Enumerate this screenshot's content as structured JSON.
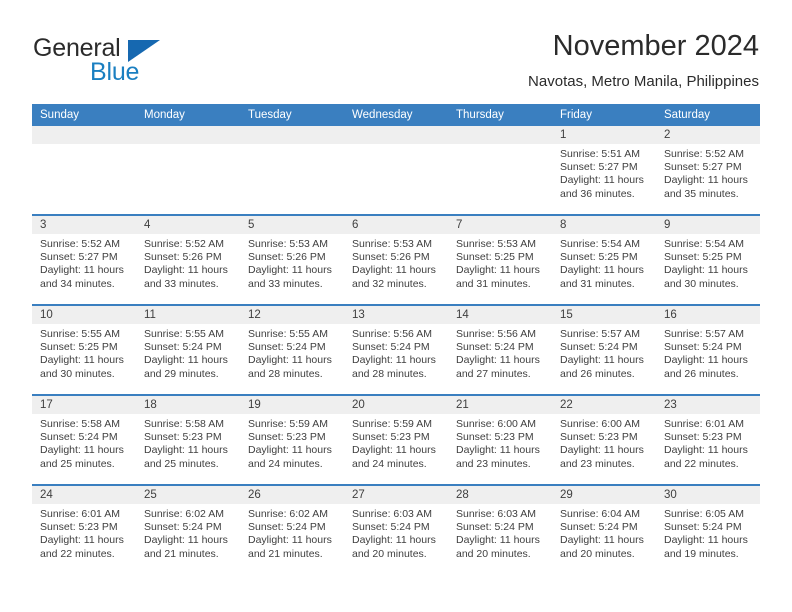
{
  "brand": {
    "word1": "General",
    "word2": "Blue",
    "logo_icon": "blue-triangle-icon",
    "accent_color": "#1668b0"
  },
  "header": {
    "month_title": "November 2024",
    "location": "Navotas, Metro Manila, Philippines"
  },
  "calendar": {
    "header_color": "#3a7fc0",
    "band_color": "#efefef",
    "weekdays": [
      "Sunday",
      "Monday",
      "Tuesday",
      "Wednesday",
      "Thursday",
      "Friday",
      "Saturday"
    ],
    "weeks": [
      [
        {
          "day": "",
          "empty": true
        },
        {
          "day": "",
          "empty": true
        },
        {
          "day": "",
          "empty": true
        },
        {
          "day": "",
          "empty": true
        },
        {
          "day": "",
          "empty": true
        },
        {
          "day": "1",
          "sunrise": "Sunrise: 5:51 AM",
          "sunset": "Sunset: 5:27 PM",
          "daylight1": "Daylight: 11 hours",
          "daylight2": "and 36 minutes."
        },
        {
          "day": "2",
          "sunrise": "Sunrise: 5:52 AM",
          "sunset": "Sunset: 5:27 PM",
          "daylight1": "Daylight: 11 hours",
          "daylight2": "and 35 minutes."
        }
      ],
      [
        {
          "day": "3",
          "sunrise": "Sunrise: 5:52 AM",
          "sunset": "Sunset: 5:27 PM",
          "daylight1": "Daylight: 11 hours",
          "daylight2": "and 34 minutes."
        },
        {
          "day": "4",
          "sunrise": "Sunrise: 5:52 AM",
          "sunset": "Sunset: 5:26 PM",
          "daylight1": "Daylight: 11 hours",
          "daylight2": "and 33 minutes."
        },
        {
          "day": "5",
          "sunrise": "Sunrise: 5:53 AM",
          "sunset": "Sunset: 5:26 PM",
          "daylight1": "Daylight: 11 hours",
          "daylight2": "and 33 minutes."
        },
        {
          "day": "6",
          "sunrise": "Sunrise: 5:53 AM",
          "sunset": "Sunset: 5:26 PM",
          "daylight1": "Daylight: 11 hours",
          "daylight2": "and 32 minutes."
        },
        {
          "day": "7",
          "sunrise": "Sunrise: 5:53 AM",
          "sunset": "Sunset: 5:25 PM",
          "daylight1": "Daylight: 11 hours",
          "daylight2": "and 31 minutes."
        },
        {
          "day": "8",
          "sunrise": "Sunrise: 5:54 AM",
          "sunset": "Sunset: 5:25 PM",
          "daylight1": "Daylight: 11 hours",
          "daylight2": "and 31 minutes."
        },
        {
          "day": "9",
          "sunrise": "Sunrise: 5:54 AM",
          "sunset": "Sunset: 5:25 PM",
          "daylight1": "Daylight: 11 hours",
          "daylight2": "and 30 minutes."
        }
      ],
      [
        {
          "day": "10",
          "sunrise": "Sunrise: 5:55 AM",
          "sunset": "Sunset: 5:25 PM",
          "daylight1": "Daylight: 11 hours",
          "daylight2": "and 30 minutes."
        },
        {
          "day": "11",
          "sunrise": "Sunrise: 5:55 AM",
          "sunset": "Sunset: 5:24 PM",
          "daylight1": "Daylight: 11 hours",
          "daylight2": "and 29 minutes."
        },
        {
          "day": "12",
          "sunrise": "Sunrise: 5:55 AM",
          "sunset": "Sunset: 5:24 PM",
          "daylight1": "Daylight: 11 hours",
          "daylight2": "and 28 minutes."
        },
        {
          "day": "13",
          "sunrise": "Sunrise: 5:56 AM",
          "sunset": "Sunset: 5:24 PM",
          "daylight1": "Daylight: 11 hours",
          "daylight2": "and 28 minutes."
        },
        {
          "day": "14",
          "sunrise": "Sunrise: 5:56 AM",
          "sunset": "Sunset: 5:24 PM",
          "daylight1": "Daylight: 11 hours",
          "daylight2": "and 27 minutes."
        },
        {
          "day": "15",
          "sunrise": "Sunrise: 5:57 AM",
          "sunset": "Sunset: 5:24 PM",
          "daylight1": "Daylight: 11 hours",
          "daylight2": "and 26 minutes."
        },
        {
          "day": "16",
          "sunrise": "Sunrise: 5:57 AM",
          "sunset": "Sunset: 5:24 PM",
          "daylight1": "Daylight: 11 hours",
          "daylight2": "and 26 minutes."
        }
      ],
      [
        {
          "day": "17",
          "sunrise": "Sunrise: 5:58 AM",
          "sunset": "Sunset: 5:24 PM",
          "daylight1": "Daylight: 11 hours",
          "daylight2": "and 25 minutes."
        },
        {
          "day": "18",
          "sunrise": "Sunrise: 5:58 AM",
          "sunset": "Sunset: 5:23 PM",
          "daylight1": "Daylight: 11 hours",
          "daylight2": "and 25 minutes."
        },
        {
          "day": "19",
          "sunrise": "Sunrise: 5:59 AM",
          "sunset": "Sunset: 5:23 PM",
          "daylight1": "Daylight: 11 hours",
          "daylight2": "and 24 minutes."
        },
        {
          "day": "20",
          "sunrise": "Sunrise: 5:59 AM",
          "sunset": "Sunset: 5:23 PM",
          "daylight1": "Daylight: 11 hours",
          "daylight2": "and 24 minutes."
        },
        {
          "day": "21",
          "sunrise": "Sunrise: 6:00 AM",
          "sunset": "Sunset: 5:23 PM",
          "daylight1": "Daylight: 11 hours",
          "daylight2": "and 23 minutes."
        },
        {
          "day": "22",
          "sunrise": "Sunrise: 6:00 AM",
          "sunset": "Sunset: 5:23 PM",
          "daylight1": "Daylight: 11 hours",
          "daylight2": "and 23 minutes."
        },
        {
          "day": "23",
          "sunrise": "Sunrise: 6:01 AM",
          "sunset": "Sunset: 5:23 PM",
          "daylight1": "Daylight: 11 hours",
          "daylight2": "and 22 minutes."
        }
      ],
      [
        {
          "day": "24",
          "sunrise": "Sunrise: 6:01 AM",
          "sunset": "Sunset: 5:23 PM",
          "daylight1": "Daylight: 11 hours",
          "daylight2": "and 22 minutes."
        },
        {
          "day": "25",
          "sunrise": "Sunrise: 6:02 AM",
          "sunset": "Sunset: 5:24 PM",
          "daylight1": "Daylight: 11 hours",
          "daylight2": "and 21 minutes."
        },
        {
          "day": "26",
          "sunrise": "Sunrise: 6:02 AM",
          "sunset": "Sunset: 5:24 PM",
          "daylight1": "Daylight: 11 hours",
          "daylight2": "and 21 minutes."
        },
        {
          "day": "27",
          "sunrise": "Sunrise: 6:03 AM",
          "sunset": "Sunset: 5:24 PM",
          "daylight1": "Daylight: 11 hours",
          "daylight2": "and 20 minutes."
        },
        {
          "day": "28",
          "sunrise": "Sunrise: 6:03 AM",
          "sunset": "Sunset: 5:24 PM",
          "daylight1": "Daylight: 11 hours",
          "daylight2": "and 20 minutes."
        },
        {
          "day": "29",
          "sunrise": "Sunrise: 6:04 AM",
          "sunset": "Sunset: 5:24 PM",
          "daylight1": "Daylight: 11 hours",
          "daylight2": "and 20 minutes."
        },
        {
          "day": "30",
          "sunrise": "Sunrise: 6:05 AM",
          "sunset": "Sunset: 5:24 PM",
          "daylight1": "Daylight: 11 hours",
          "daylight2": "and 19 minutes."
        }
      ]
    ]
  }
}
